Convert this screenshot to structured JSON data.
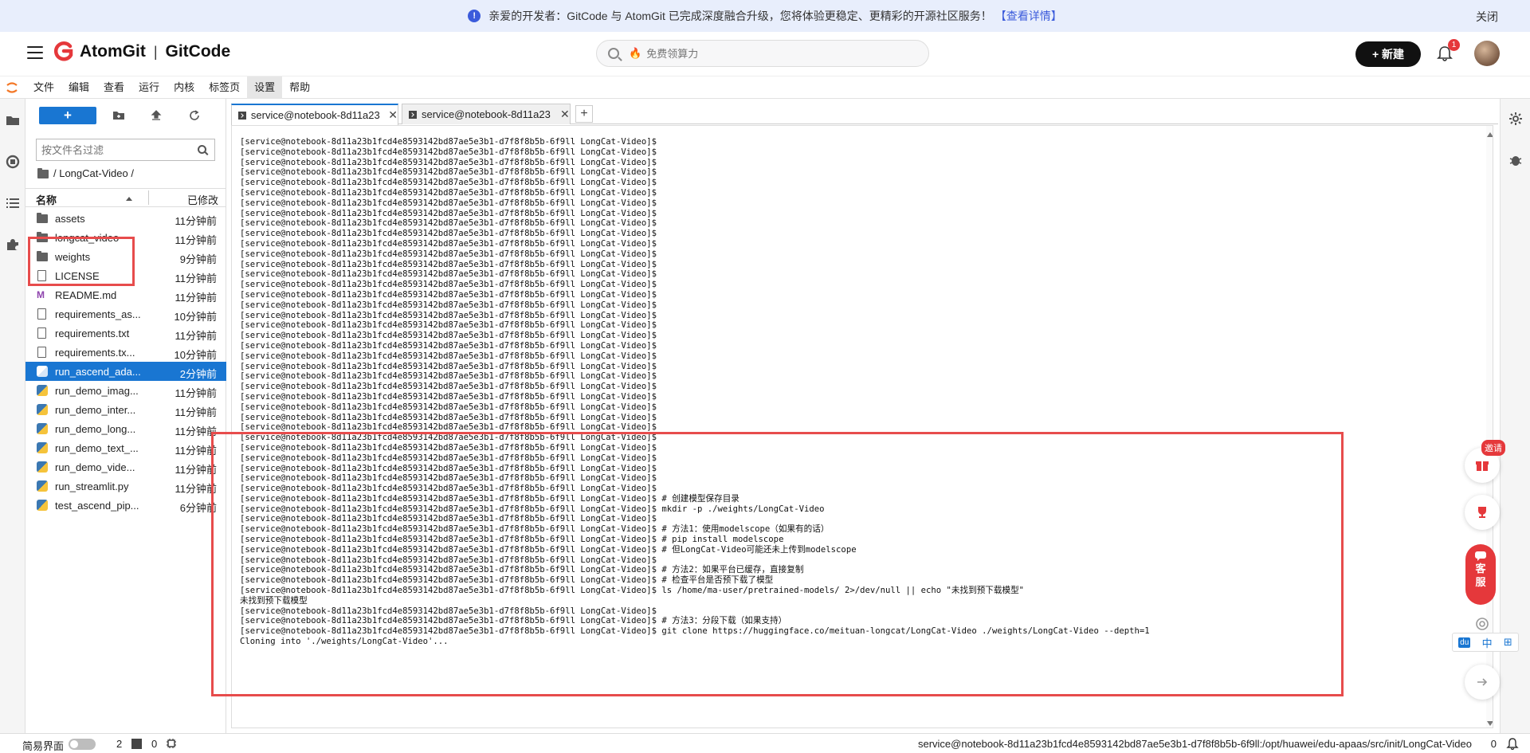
{
  "announcement": {
    "text": "亲爱的开发者：GitCode 与 AtomGit 已完成深度融合升级，您将体验更稳定、更精彩的开源社区服务！",
    "link": "【查看详情】",
    "close": "关闭"
  },
  "header": {
    "brand_left": "AtomGit",
    "brand_sep": "|",
    "brand_right": "GitCode",
    "search_placeholder": "免费领算力",
    "new_label": "+ 新建",
    "notification_count": "1"
  },
  "menubar": {
    "items": [
      {
        "label": "文件"
      },
      {
        "label": "编辑"
      },
      {
        "label": "查看"
      },
      {
        "label": "运行"
      },
      {
        "label": "内核"
      },
      {
        "label": "标签页"
      },
      {
        "label": "设置"
      },
      {
        "label": "帮助"
      }
    ]
  },
  "filebrowser": {
    "new_label": "+",
    "filter_placeholder": "按文件名过滤",
    "breadcrumb": "/ LongCat-Video /",
    "col_name": "名称",
    "col_modified": "已修改",
    "files": [
      {
        "name": "assets",
        "time": "11分钟前",
        "type": "folder"
      },
      {
        "name": "longcat_video",
        "time": "11分钟前",
        "type": "folder"
      },
      {
        "name": "weights",
        "time": "9分钟前",
        "type": "folder"
      },
      {
        "name": "LICENSE",
        "time": "11分钟前",
        "type": "file"
      },
      {
        "name": "README.md",
        "time": "11分钟前",
        "type": "md"
      },
      {
        "name": "requirements_as...",
        "time": "10分钟前",
        "type": "file"
      },
      {
        "name": "requirements.txt",
        "time": "11分钟前",
        "type": "file"
      },
      {
        "name": "requirements.tx...",
        "time": "10分钟前",
        "type": "file"
      },
      {
        "name": "run_ascend_ada...",
        "time": "2分钟前",
        "type": "py",
        "selected": true
      },
      {
        "name": "run_demo_imag...",
        "time": "11分钟前",
        "type": "py"
      },
      {
        "name": "run_demo_inter...",
        "time": "11分钟前",
        "type": "py"
      },
      {
        "name": "run_demo_long...",
        "time": "11分钟前",
        "type": "py"
      },
      {
        "name": "run_demo_text_...",
        "time": "11分钟前",
        "type": "py"
      },
      {
        "name": "run_demo_vide...",
        "time": "11分钟前",
        "type": "py"
      },
      {
        "name": "run_streamlit.py",
        "time": "11分钟前",
        "type": "py"
      },
      {
        "name": "test_ascend_pip...",
        "time": "6分钟前",
        "type": "py"
      }
    ]
  },
  "tabs": [
    {
      "label": "service@notebook-8d11a23",
      "active": true
    },
    {
      "label": "service@notebook-8d11a23",
      "active": false
    }
  ],
  "terminal": {
    "prompt": "[service@notebook-8d11a23b1fcd4e8593142bd87ae5e3b1-d7f8f8b5b-6f9ll LongCat-Video]$",
    "blank_prompt_count": 35,
    "tail_lines": [
      "[service@notebook-8d11a23b1fcd4e8593142bd87ae5e3b1-d7f8f8b5b-6f9ll LongCat-Video]$ # 创建模型保存目录",
      "[service@notebook-8d11a23b1fcd4e8593142bd87ae5e3b1-d7f8f8b5b-6f9ll LongCat-Video]$ mkdir -p ./weights/LongCat-Video",
      "[service@notebook-8d11a23b1fcd4e8593142bd87ae5e3b1-d7f8f8b5b-6f9ll LongCat-Video]$",
      "[service@notebook-8d11a23b1fcd4e8593142bd87ae5e3b1-d7f8f8b5b-6f9ll LongCat-Video]$ # 方法1：使用modelscope（如果有的话）",
      "[service@notebook-8d11a23b1fcd4e8593142bd87ae5e3b1-d7f8f8b5b-6f9ll LongCat-Video]$ # pip install modelscope",
      "[service@notebook-8d11a23b1fcd4e8593142bd87ae5e3b1-d7f8f8b5b-6f9ll LongCat-Video]$ # 但LongCat-Video可能还未上传到modelscope",
      "[service@notebook-8d11a23b1fcd4e8593142bd87ae5e3b1-d7f8f8b5b-6f9ll LongCat-Video]$",
      "[service@notebook-8d11a23b1fcd4e8593142bd87ae5e3b1-d7f8f8b5b-6f9ll LongCat-Video]$ # 方法2：如果平台已缓存，直接复制",
      "[service@notebook-8d11a23b1fcd4e8593142bd87ae5e3b1-d7f8f8b5b-6f9ll LongCat-Video]$ # 检查平台是否预下载了模型",
      "[service@notebook-8d11a23b1fcd4e8593142bd87ae5e3b1-d7f8f8b5b-6f9ll LongCat-Video]$ ls /home/ma-user/pretrained-models/ 2>/dev/null || echo \"未找到预下载模型\"",
      "未找到预下载模型",
      "[service@notebook-8d11a23b1fcd4e8593142bd87ae5e3b1-d7f8f8b5b-6f9ll LongCat-Video]$",
      "[service@notebook-8d11a23b1fcd4e8593142bd87ae5e3b1-d7f8f8b5b-6f9ll LongCat-Video]$ # 方法3：分段下载（如果支持）",
      "[service@notebook-8d11a23b1fcd4e8593142bd87ae5e3b1-d7f8f8b5b-6f9ll LongCat-Video]$ git clone https://huggingface.co/meituan-longcat/LongCat-Video ./weights/LongCat-Video --depth=1",
      "Cloning into './weights/LongCat-Video'..."
    ]
  },
  "floating": {
    "invite": "邀请",
    "kefu_1": "客",
    "kefu_2": "服",
    "ime_zh": "中"
  },
  "statusbar": {
    "simple_mode": "简易界面",
    "count_a": "2",
    "count_b": "0",
    "path": "service@notebook-8d11a23b1fcd4e8593142bd87ae5e3b1-d7f8f8b5b-6f9ll:/opt/huawei/edu-apaas/src/init/LongCat-Video",
    "right_count": "0"
  },
  "colors": {
    "accent": "#1976d2",
    "highlight": "#e74c4c",
    "announce_bg": "#e8eefc"
  }
}
